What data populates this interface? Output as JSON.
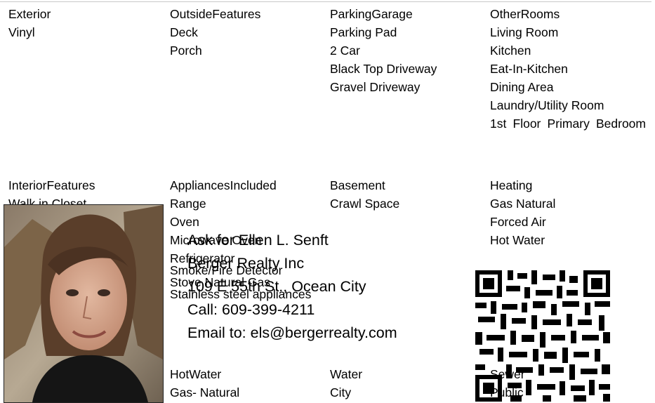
{
  "sections": {
    "exterior": {
      "title": "Exterior",
      "items": [
        "Vinyl"
      ]
    },
    "outside_features": {
      "title": "OutsideFeatures",
      "items": [
        "Deck",
        "Porch"
      ]
    },
    "parking_garage": {
      "title": "ParkingGarage",
      "items": [
        "Parking Pad",
        "2 Car",
        "Black Top Driveway",
        "Gravel Driveway"
      ]
    },
    "other_rooms": {
      "title": "OtherRooms",
      "items": [
        "Living Room",
        "Kitchen",
        "Eat-In-Kitchen",
        "Dining Area",
        "Laundry/Utility Room"
      ],
      "wrapped_item": "1st Floor Primary Bedroom"
    },
    "interior_features": {
      "title": "InteriorFeatures",
      "items": [
        "Walk in Closet"
      ]
    },
    "appliances_included": {
      "title": "AppliancesIncluded",
      "items": [
        "Range",
        "Oven",
        "Microwave Oven",
        "Refrigerator",
        "Smoke/Fire Detector",
        "Stove Natural Gas",
        "Stainless steel appliances"
      ]
    },
    "basement": {
      "title": "Basement",
      "items": [
        "Crawl Space"
      ]
    },
    "heating": {
      "title": "Heating",
      "items": [
        "Gas Natural",
        "Forced Air",
        "Hot Water"
      ]
    },
    "hot_water": {
      "title": "HotWater",
      "items": [
        "Gas- Natural"
      ]
    },
    "water": {
      "title": "Water",
      "items": [
        "City"
      ]
    },
    "sewer": {
      "title": "Sewer",
      "items": [
        "Public"
      ]
    }
  },
  "agent": {
    "line1": "Ask for Ellen L. Senft",
    "line2": "Berger Realty Inc",
    "line3": "109 E 55th St., Ocean City",
    "line4": "Call: 609-399-4211",
    "line5": "Email to: els@bergerrealty.com"
  },
  "icons": {
    "photo": "agent-photo",
    "qr": "qr-code-icon"
  },
  "colors": {
    "text": "#000000",
    "divider": "#c8c8c8"
  }
}
